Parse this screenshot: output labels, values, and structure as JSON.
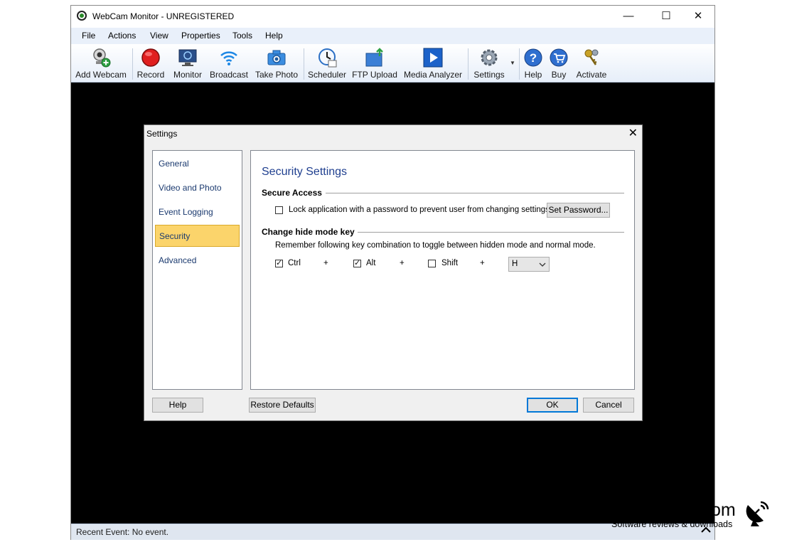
{
  "window": {
    "title": "WebCam Monitor - UNREGISTERED",
    "minimize": "—",
    "maximize": "☐",
    "close": "✕"
  },
  "menu": [
    "File",
    "Actions",
    "View",
    "Properties",
    "Tools",
    "Help"
  ],
  "toolbar": {
    "add_webcam": "Add Webcam",
    "record": "Record",
    "monitor": "Monitor",
    "broadcast": "Broadcast",
    "take_photo": "Take Photo",
    "scheduler": "Scheduler",
    "ftp_upload": "FTP Upload",
    "media_analyzer": "Media Analyzer",
    "settings": "Settings",
    "help": "Help",
    "buy": "Buy",
    "activate": "Activate"
  },
  "status": {
    "text": "Recent Event: No event."
  },
  "dialog": {
    "title": "Settings",
    "close": "✕",
    "nav": [
      "General",
      "Video and Photo",
      "Event Logging",
      "Security",
      "Advanced"
    ],
    "selected_nav": "Security",
    "heading": "Security Settings",
    "secure_access": {
      "label": "Secure Access",
      "lock_label": "Lock application with a password to prevent user from changing settings:",
      "lock_checked": false,
      "set_password": "Set Password..."
    },
    "hide_mode": {
      "label": "Change hide mode key",
      "description": "Remember following key combination to toggle between hidden mode and normal mode.",
      "ctrl_label": "Ctrl",
      "ctrl_checked": true,
      "alt_label": "Alt",
      "alt_checked": true,
      "shift_label": "Shift",
      "shift_checked": false,
      "plus": "+",
      "key_value": "H"
    },
    "buttons": {
      "help": "Help",
      "restore": "Restore Defaults",
      "ok": "OK",
      "cancel": "Cancel"
    }
  },
  "watermark": {
    "line1": "om",
    "line2": "Software reviews & downloads"
  },
  "colors": {
    "accent_selected": "#fbd46b",
    "heading": "#1f3f8f",
    "nav_text": "#1b3a6f"
  }
}
